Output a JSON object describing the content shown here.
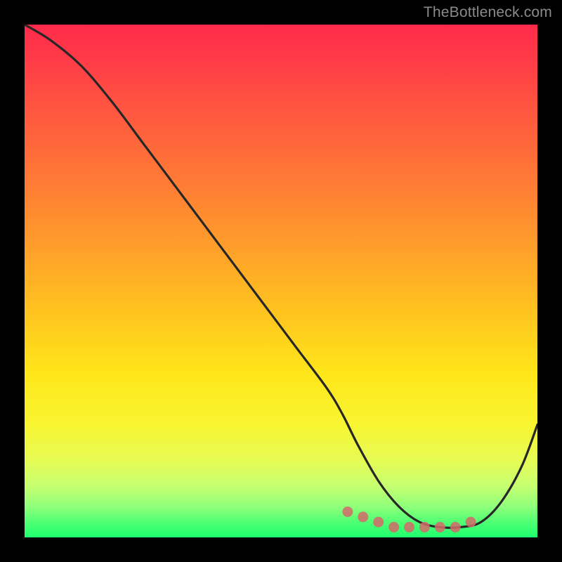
{
  "watermark": {
    "text": "TheBottleneck.com"
  },
  "colors": {
    "background": "#000000",
    "curve_stroke": "#272727",
    "marker_fill": "#d46a6a",
    "gradient_top": "#ff2a4a",
    "gradient_bottom": "#1eff6e"
  },
  "chart_data": {
    "type": "line",
    "title": "",
    "xlabel": "",
    "ylabel": "",
    "xlim": [
      0,
      100
    ],
    "ylim": [
      0,
      100
    ],
    "grid": false,
    "legend": false,
    "series": [
      {
        "name": "bottleneck-curve",
        "x": [
          0,
          5,
          11,
          17,
          23,
          29,
          35,
          41,
          47,
          53,
          59,
          62,
          65,
          69,
          73,
          77,
          81,
          85,
          89,
          93,
          97,
          100
        ],
        "values": [
          100,
          97,
          92,
          85,
          77,
          69,
          61,
          53,
          45,
          37,
          29,
          24,
          18,
          11,
          6,
          3,
          2,
          2,
          3,
          7,
          14,
          22
        ]
      }
    ],
    "markers": {
      "name": "highlight-dots",
      "x": [
        63,
        66,
        69,
        72,
        75,
        78,
        81,
        84,
        87
      ],
      "values": [
        5,
        4,
        3,
        2,
        2,
        2,
        2,
        2,
        3
      ]
    },
    "background_gradient": {
      "orientation": "vertical",
      "stops": [
        {
          "pos": 0.0,
          "color": "#ff2a4a"
        },
        {
          "pos": 0.32,
          "color": "#ff7e34"
        },
        {
          "pos": 0.58,
          "color": "#ffc91e"
        },
        {
          "pos": 0.78,
          "color": "#f8f531"
        },
        {
          "pos": 1.0,
          "color": "#1eff6e"
        }
      ]
    }
  }
}
